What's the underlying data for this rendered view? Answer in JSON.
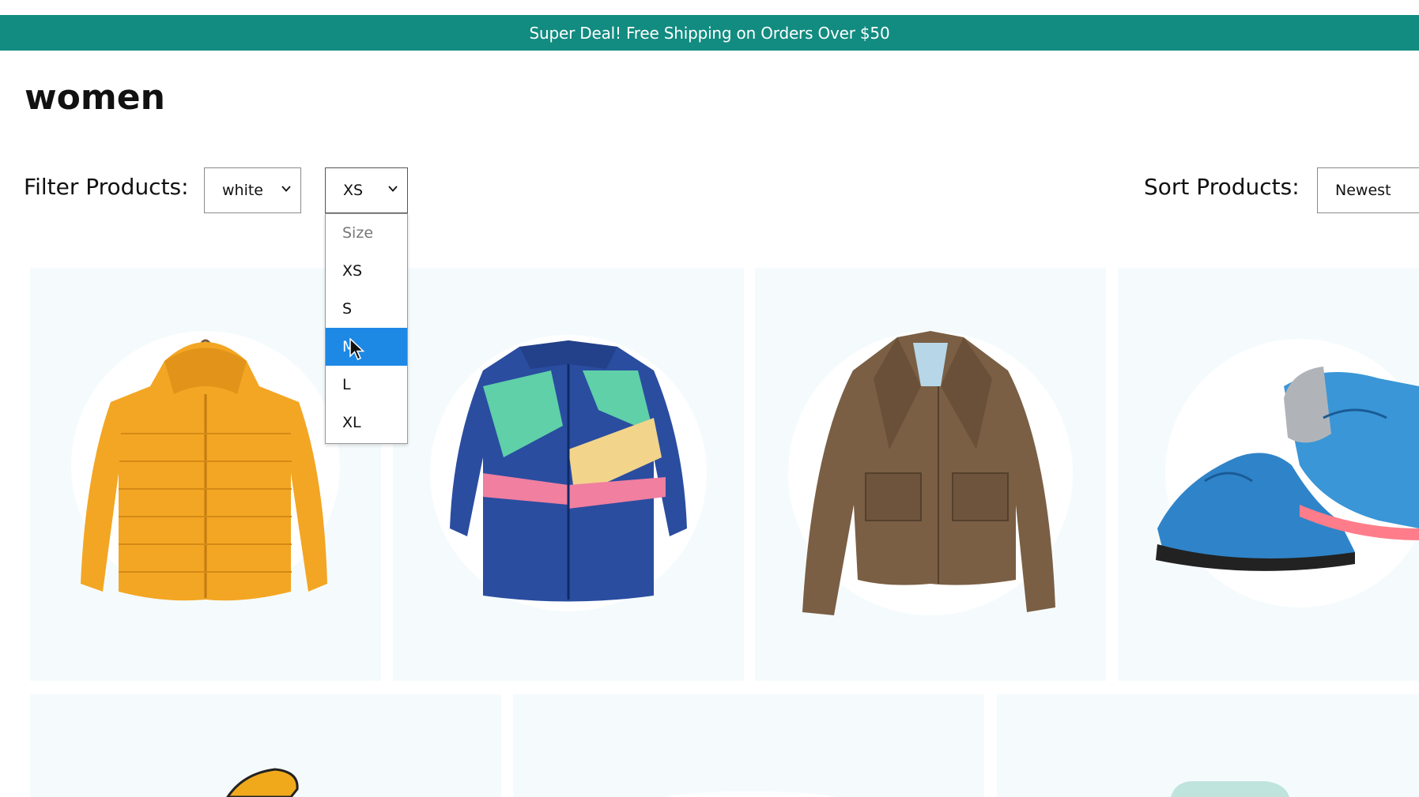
{
  "announcement": {
    "text": "Super Deal! Free Shipping on Orders Over $50"
  },
  "page": {
    "title": "women"
  },
  "filters": {
    "label": "Filter Products:",
    "color_value": "white",
    "size_value": "XS",
    "size_options": [
      "Size",
      "XS",
      "S",
      "M",
      "L",
      "XL"
    ],
    "highlighted_option": "M"
  },
  "sort": {
    "label": "Sort Products:",
    "value": "Newest"
  },
  "products": [
    {
      "image": "yellow-puffer-jacket-image"
    },
    {
      "image": "colorblock-windbreaker-image"
    },
    {
      "image": "brown-field-jacket-image"
    },
    {
      "image": "blue-running-shoes-image"
    },
    {
      "image": "product-image"
    },
    {
      "image": "product-image"
    },
    {
      "image": "product-image"
    }
  ],
  "colors": {
    "announcement_bg": "#128b80",
    "option_highlight": "#1e88e5",
    "card_bg": "#f5fbfd"
  }
}
